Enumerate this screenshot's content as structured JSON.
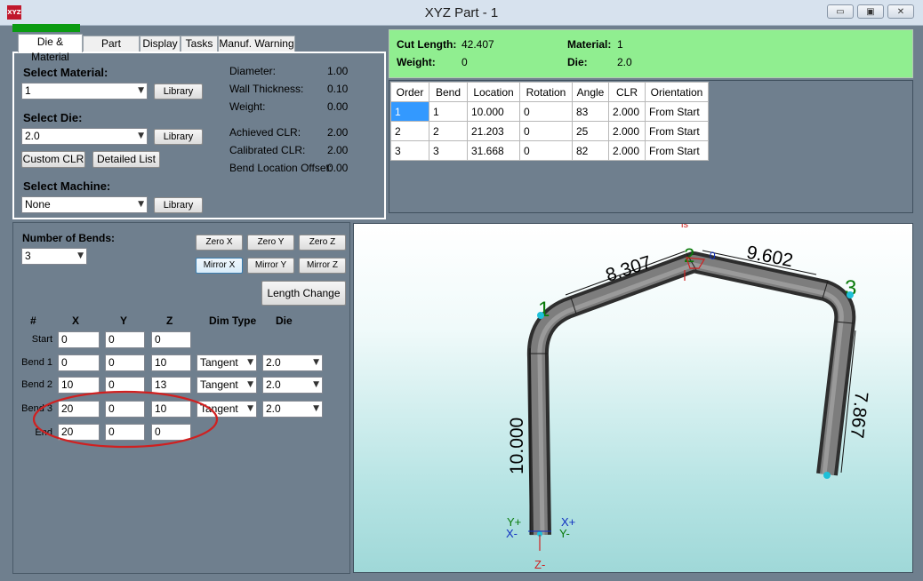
{
  "window": {
    "title": "XYZ Part - 1",
    "icon_text": "XYZ",
    "minimize": "▭",
    "maximize": "▣",
    "close": "✕"
  },
  "tabs": [
    "Die & Material",
    "Part Details",
    "Display",
    "Tasks",
    "Manuf. Warning"
  ],
  "die_material": {
    "select_material_label": "Select Material:",
    "material_value": "1",
    "library_label": "Library",
    "select_die_label": "Select Die:",
    "die_value": "2.0",
    "custom_clr_label": "Custom CLR",
    "detailed_list_label": "Detailed List",
    "select_machine_label": "Select Machine:",
    "machine_value": "None",
    "props": [
      {
        "label": "Diameter:",
        "value": "1.00"
      },
      {
        "label": "Wall Thickness:",
        "value": "0.10"
      },
      {
        "label": "Weight:",
        "value": "0.00"
      },
      {
        "label": "Achieved CLR:",
        "value": "2.00"
      },
      {
        "label": "Calibrated CLR:",
        "value": "2.00"
      },
      {
        "label": "Bend Location Offset:",
        "value": "0.00"
      }
    ]
  },
  "summary": {
    "cut_length_label": "Cut Length:",
    "cut_length": "42.407",
    "weight_label": "Weight:",
    "weight": "0",
    "material_label": "Material:",
    "material": "1",
    "die_label": "Die:",
    "die": "2.0"
  },
  "grid": {
    "headers": [
      "Order",
      "Bend",
      "Location",
      "Rotation",
      "Angle",
      "CLR",
      "Orientation"
    ],
    "rows": [
      [
        "1",
        "1",
        "10.000",
        "0",
        "83",
        "2.000",
        "From Start"
      ],
      [
        "2",
        "2",
        "21.203",
        "0",
        "25",
        "2.000",
        "From Start"
      ],
      [
        "3",
        "3",
        "31.668",
        "0",
        "82",
        "2.000",
        "From Start"
      ]
    ]
  },
  "bends": {
    "number_label": "Number of Bends:",
    "number_value": "3",
    "zero_x": "Zero X",
    "zero_y": "Zero Y",
    "zero_z": "Zero Z",
    "mirror_x": "Mirror X",
    "mirror_y": "Mirror Y",
    "mirror_z": "Mirror Z",
    "length_change": "Length Change",
    "col_hash": "#",
    "col_x": "X",
    "col_y": "Y",
    "col_z": "Z",
    "col_dim": "Dim Type",
    "col_die": "Die",
    "rows": [
      {
        "label": "Start",
        "x": "0",
        "y": "0",
        "z": "0",
        "dim": "",
        "die": ""
      },
      {
        "label": "Bend 1",
        "x": "0",
        "y": "0",
        "z": "10",
        "dim": "Tangent",
        "die": "2.0"
      },
      {
        "label": "Bend 2",
        "x": "10",
        "y": "0",
        "z": "13",
        "dim": "Tangent",
        "die": "2.0"
      },
      {
        "label": "Bend 3",
        "x": "20",
        "y": "0",
        "z": "10",
        "dim": "Tangent",
        "die": "2.0"
      },
      {
        "label": "End",
        "x": "20",
        "y": "0",
        "z": "0",
        "dim": "",
        "die": ""
      }
    ]
  },
  "viewport": {
    "dims": [
      "8.307",
      "9.602",
      "7.867",
      "10.000"
    ],
    "bend_labels": [
      "1",
      "2",
      "3"
    ],
    "axes": {
      "y_plus": "Y+",
      "x_minus": "X-",
      "x_plus": "X+",
      "y_minus": "Y-",
      "z_minus": "Z-",
      "z_plus_top": "is",
      "zero": "0"
    }
  },
  "colors": {
    "background": "#6f7f8e",
    "summary_green": "#90ee90",
    "progress": "#0b9b12",
    "highlight": "#3399ff",
    "annotation": "#d02020"
  }
}
